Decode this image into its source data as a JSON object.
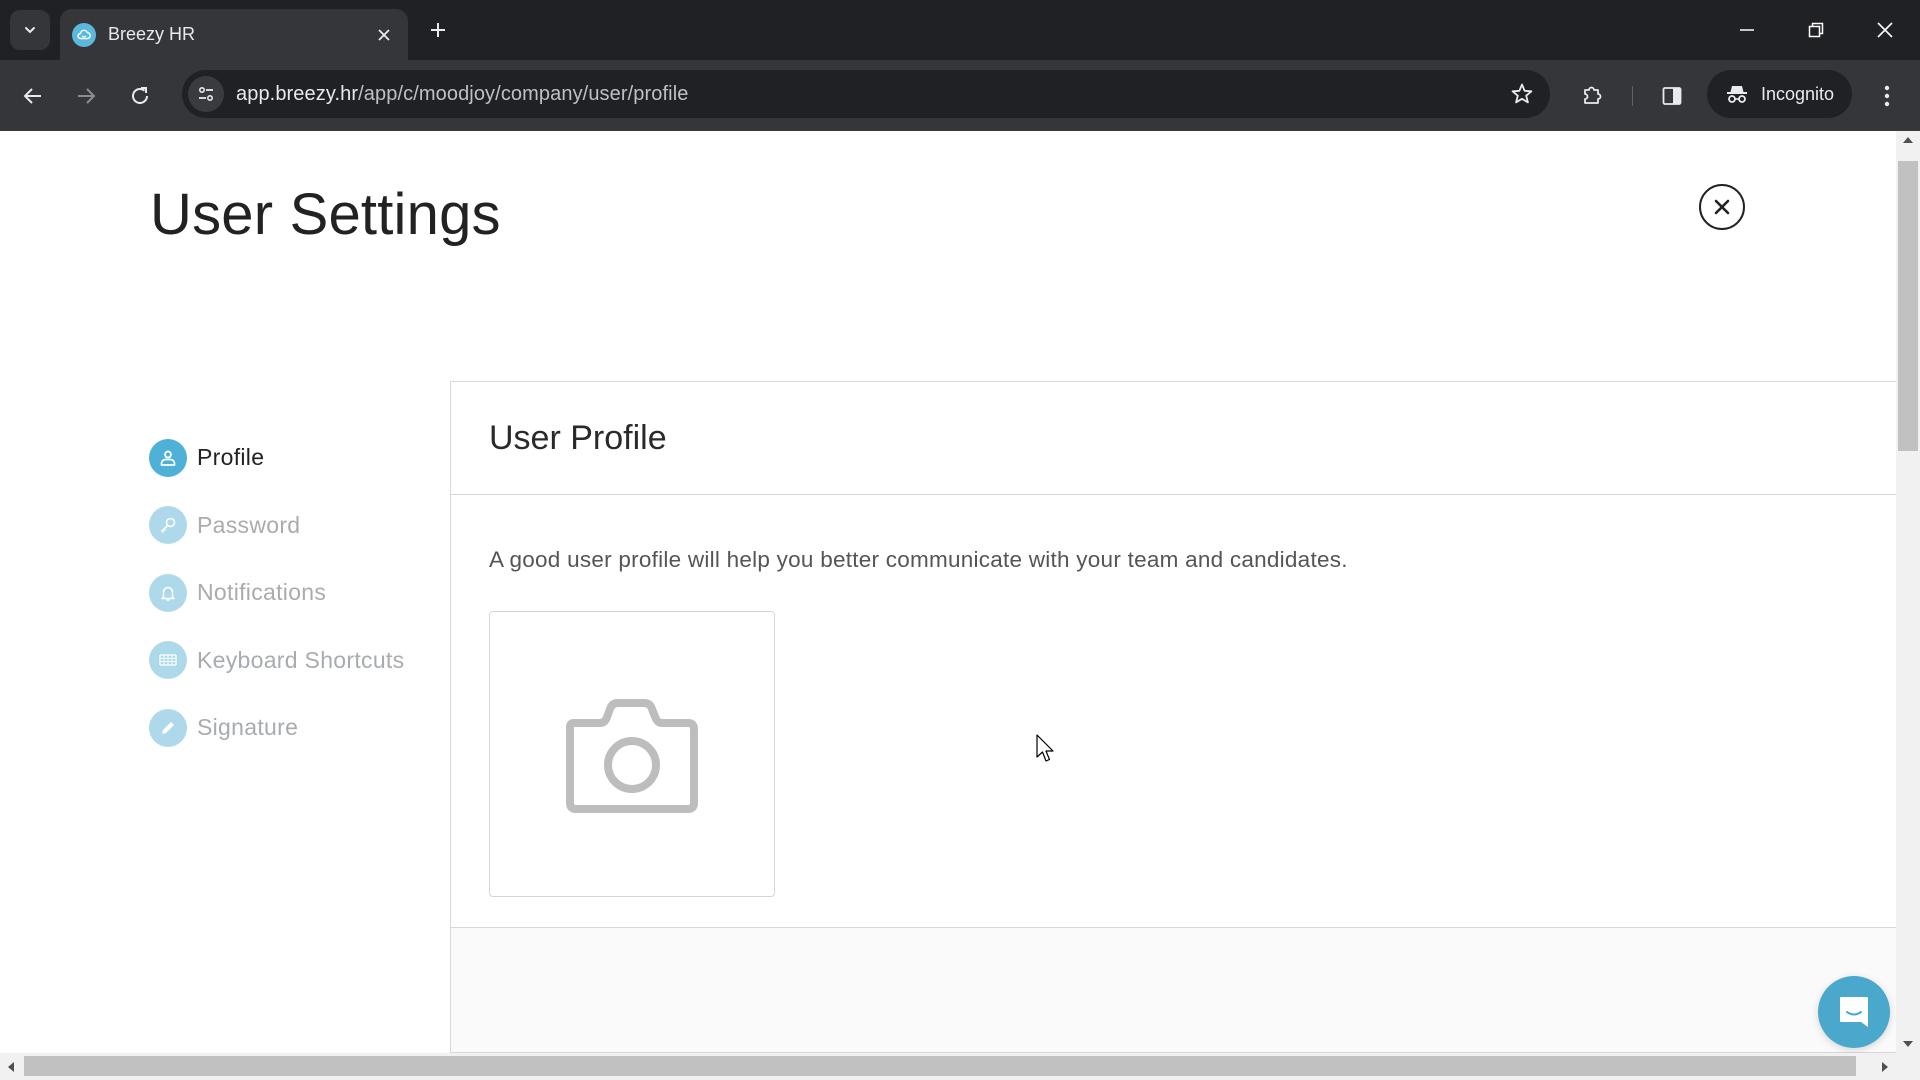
{
  "browser": {
    "tab": {
      "title": "Breezy HR",
      "favicon": "breezy-cloud-icon"
    },
    "url": {
      "domain": "app.breezy.hr",
      "path": "/app/c/moodjoy/company/user/profile"
    },
    "incognito_label": "Incognito",
    "icons": {
      "tab_search": "chevron-down-icon",
      "tab_close": "close-icon",
      "new_tab": "plus-icon",
      "back": "arrow-left-icon",
      "forward": "arrow-right-icon",
      "reload": "reload-icon",
      "site_info": "tune-icon",
      "bookmark": "star-icon",
      "extensions": "puzzle-icon",
      "side_panel": "side-panel-icon",
      "incognito": "incognito-icon",
      "menu": "kebab-menu-icon",
      "minimize": "minimize-icon",
      "restore": "restore-icon",
      "close_window": "close-icon"
    }
  },
  "page": {
    "title": "User Settings",
    "close_icon": "close-circle-icon",
    "sidebar": {
      "items": [
        {
          "label": "Profile",
          "icon": "user-icon",
          "active": true
        },
        {
          "label": "Password",
          "icon": "key-icon",
          "active": false
        },
        {
          "label": "Notifications",
          "icon": "bell-icon",
          "active": false
        },
        {
          "label": "Keyboard Shortcuts",
          "icon": "keyboard-icon",
          "active": false
        },
        {
          "label": "Signature",
          "icon": "pencil-icon",
          "active": false
        }
      ]
    },
    "panel": {
      "title": "User Profile",
      "description": "A good user profile will help you better communicate with your team and candidates.",
      "photo_placeholder_icon": "camera-icon"
    },
    "chat_launcher_icon": "chat-icon"
  },
  "colors": {
    "accent": "#4fb1d8",
    "accent_light": "#add9ea",
    "chat_button": "#4aa8cd",
    "title_text": "#222222",
    "muted_text": "#a8acaf"
  }
}
